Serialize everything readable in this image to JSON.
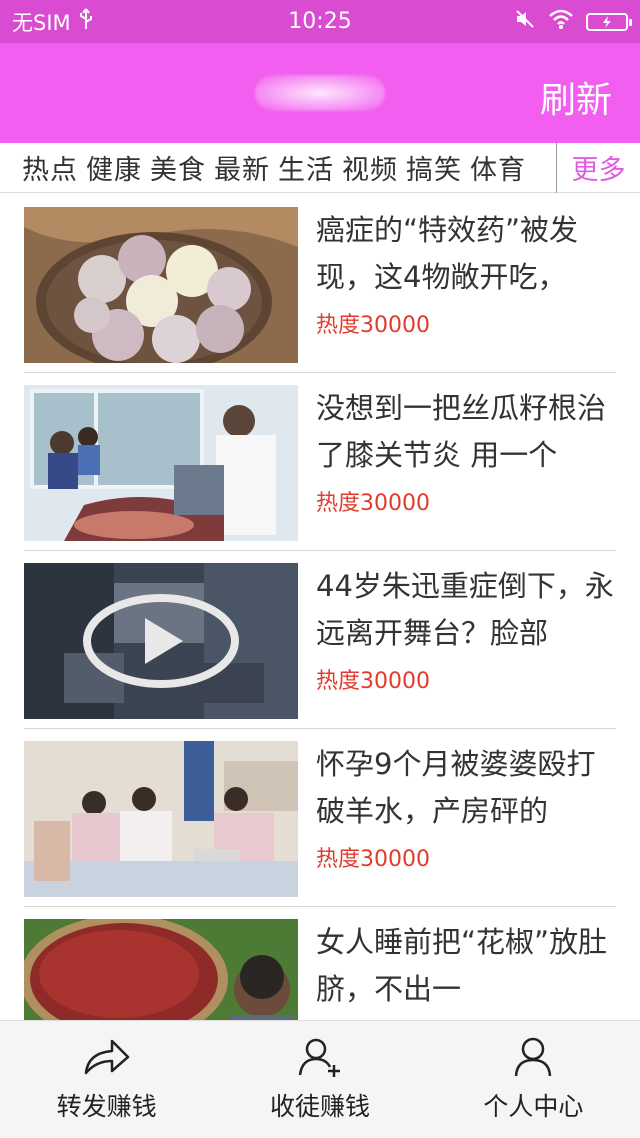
{
  "status_bar": {
    "carrier": "无SIM",
    "time": "10:25"
  },
  "header": {
    "refresh_label": "刷新"
  },
  "categories": {
    "items": [
      "热点",
      "健康",
      "美食",
      "最新",
      "生活",
      "视频",
      "搞笑",
      "体育"
    ],
    "more_label": "更多"
  },
  "news": [
    {
      "title": "癌症的“特效药”被发现，这4物敞开吃，",
      "heat": "热度30000",
      "thumb": "garlic"
    },
    {
      "title": "没想到一把丝瓜籽根治了膝关节炎 用一个",
      "heat": "热度30000",
      "thumb": "clinic"
    },
    {
      "title": "44岁朱迅重症倒下，永远离开舞台？脸部",
      "heat": "热度30000",
      "thumb": "video"
    },
    {
      "title": "怀孕9个月被婆婆殴打破羊水，产房砰的",
      "heat": "热度30000",
      "thumb": "hospital"
    },
    {
      "title": "女人睡前把“花椒”放肚脐，不出一",
      "heat": "",
      "thumb": "pepper"
    }
  ],
  "bottom_nav": {
    "items": [
      {
        "label": "转发赚钱",
        "icon": "share-icon"
      },
      {
        "label": "收徒赚钱",
        "icon": "add-user-icon"
      },
      {
        "label": "个人中心",
        "icon": "user-icon"
      }
    ]
  },
  "colors": {
    "status_bar": "#d94bd0",
    "header": "#f25ff0",
    "accent": "#e05ce0",
    "heat": "#e23b2e"
  }
}
